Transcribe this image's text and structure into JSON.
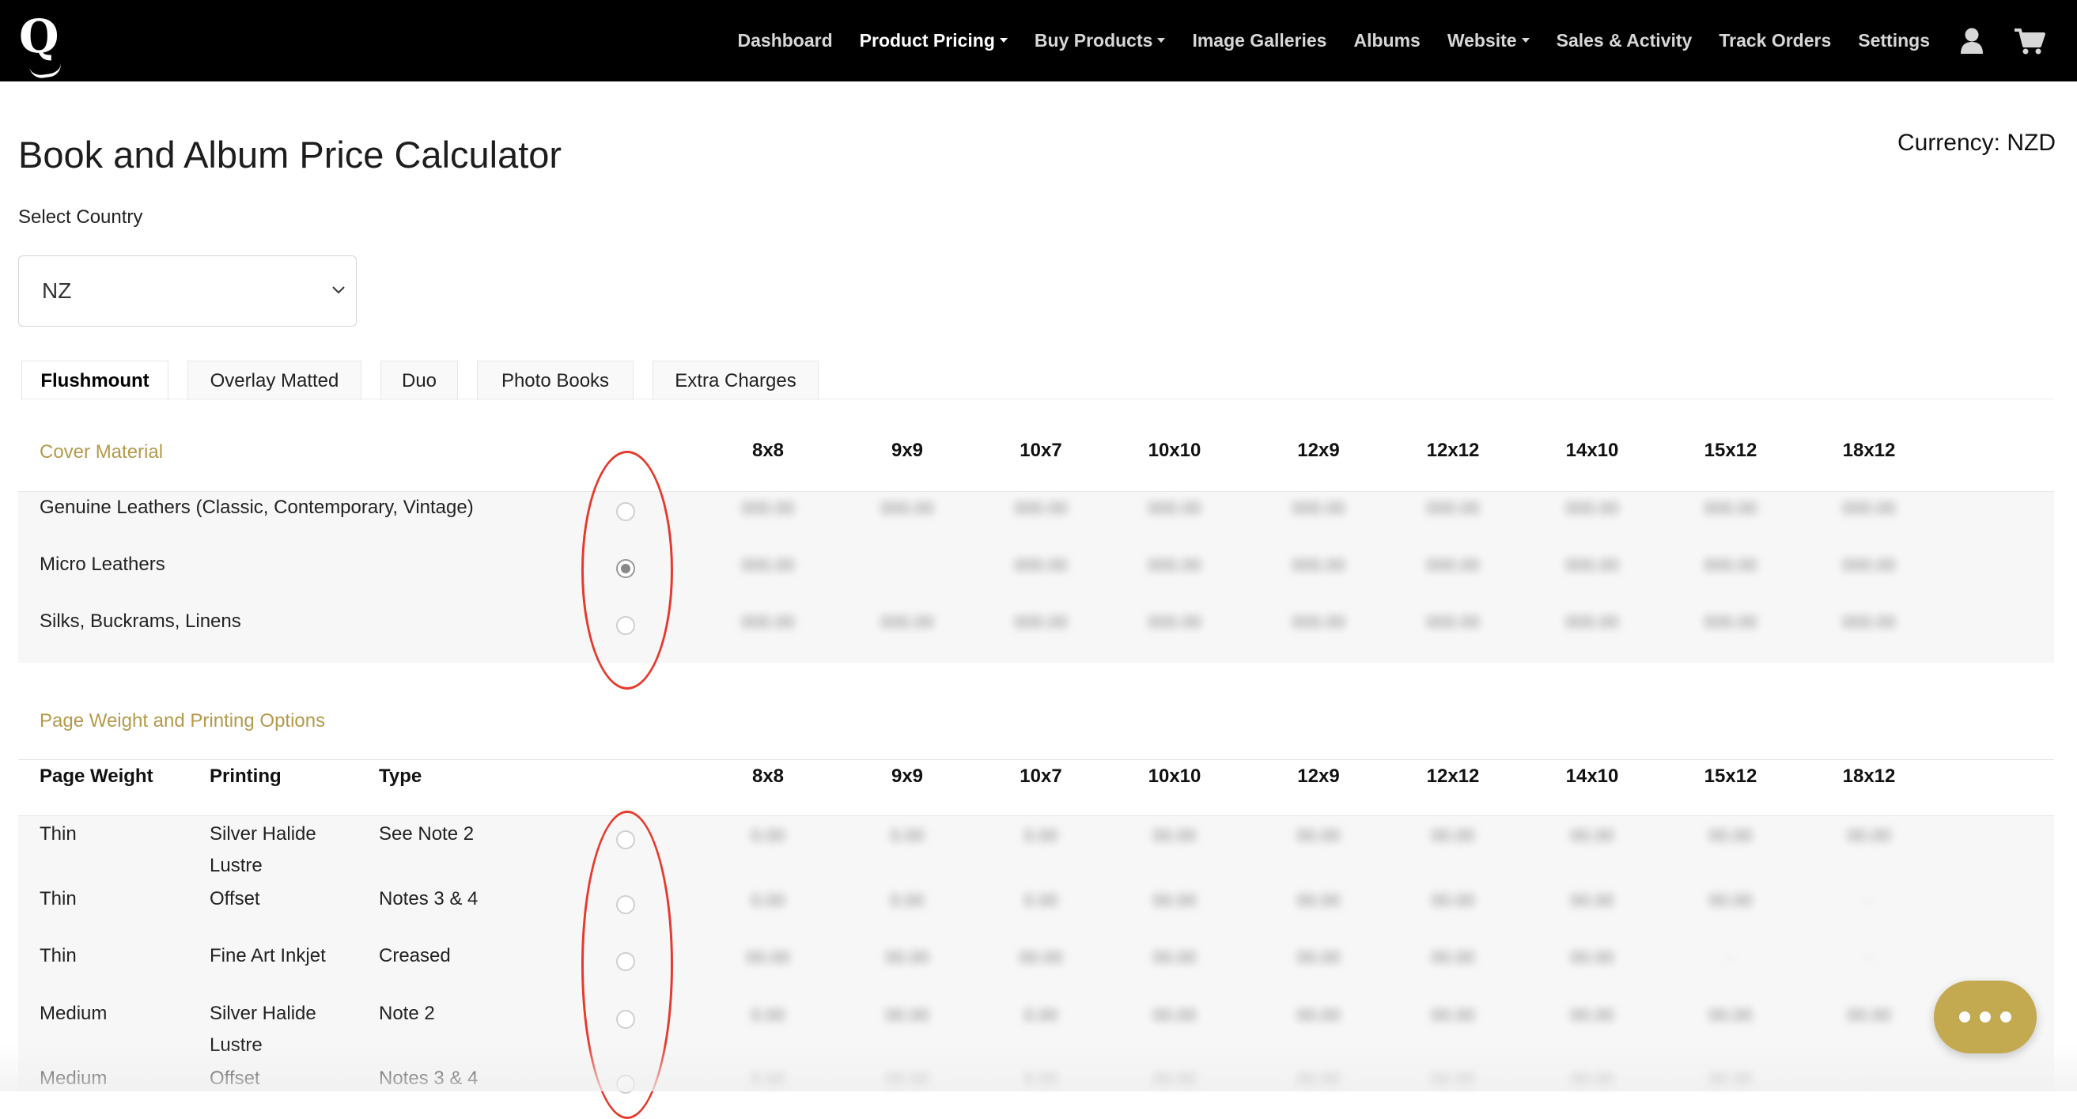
{
  "nav": {
    "items": [
      {
        "label": "Dashboard",
        "dropdown": false,
        "active": false
      },
      {
        "label": "Product Pricing",
        "dropdown": true,
        "active": true
      },
      {
        "label": "Buy Products",
        "dropdown": true,
        "active": false
      },
      {
        "label": "Image Galleries",
        "dropdown": false,
        "active": false
      },
      {
        "label": "Albums",
        "dropdown": false,
        "active": false
      },
      {
        "label": "Website",
        "dropdown": true,
        "active": false
      },
      {
        "label": "Sales & Activity",
        "dropdown": false,
        "active": false
      },
      {
        "label": "Track Orders",
        "dropdown": false,
        "active": false
      },
      {
        "label": "Settings",
        "dropdown": false,
        "active": false
      }
    ],
    "icons": [
      "user-icon",
      "cart-icon"
    ]
  },
  "page": {
    "title": "Book and Album Price Calculator",
    "currency": "Currency: NZD",
    "select_label": "Select Country",
    "country_value": "NZ"
  },
  "tabs": [
    "Flushmount",
    "Overlay Matted",
    "Duo",
    "Photo Books",
    "Extra Charges"
  ],
  "active_tab": "Flushmount",
  "sizes": [
    "8x8",
    "9x9",
    "10x7",
    "10x10",
    "12x9",
    "12x12",
    "14x10",
    "15x12",
    "18x12"
  ],
  "cover": {
    "title": "Cover Material",
    "rows": [
      {
        "label": "Genuine Leathers (Classic, Contemporary, Vintage)",
        "checked": false,
        "prices": [
          "000.00",
          "000.00",
          "000.00",
          "000.00",
          "000.00",
          "000.00",
          "000.00",
          "000.00",
          "000.00"
        ]
      },
      {
        "label": "Micro Leathers",
        "checked": true,
        "prices": [
          "000.00",
          "",
          "000.00",
          "000.00",
          "000.00",
          "000.00",
          "000.00",
          "000.00",
          "000.00"
        ]
      },
      {
        "label": "Silks, Buckrams, Linens",
        "checked": false,
        "prices": [
          "000.00",
          "000.00",
          "000.00",
          "000.00",
          "000.00",
          "000.00",
          "000.00",
          "000.00",
          "000.00"
        ]
      }
    ]
  },
  "pages": {
    "title": "Page Weight and Printing Options",
    "headers": [
      "Page Weight",
      "Printing",
      "Type"
    ],
    "rows": [
      {
        "weight": "Thin",
        "printing": "Silver Halide Lustre",
        "type": "See Note 2",
        "checked": false,
        "prices": [
          "0.00",
          "0.00",
          "0.00",
          "00.00",
          "00.00",
          "00.00",
          "00.00",
          "00.00",
          "00.00"
        ]
      },
      {
        "weight": "Thin",
        "printing": "Offset",
        "type": "Notes 3 & 4",
        "checked": false,
        "prices": [
          "0.00",
          "0.00",
          "0.00",
          "00.00",
          "00.00",
          "00.00",
          "00.00",
          "00.00",
          "-"
        ]
      },
      {
        "weight": "Thin",
        "printing": "Fine Art Inkjet",
        "type": "Creased",
        "checked": false,
        "prices": [
          "00.00",
          "00.00",
          "00.00",
          "00.00",
          "00.00",
          "00.00",
          "00.00",
          "-",
          "-"
        ]
      },
      {
        "weight": "Medium",
        "printing": "Silver Halide Lustre",
        "type": "Note 2",
        "checked": false,
        "prices": [
          "0.00",
          "00.00",
          "0.00",
          "00.00",
          "00.00",
          "00.00",
          "00.00",
          "00.00",
          "00.00"
        ]
      },
      {
        "weight": "Medium",
        "printing": "Offset",
        "type": "Notes 3 & 4",
        "checked": false,
        "prices": [
          "0.00",
          "00.00",
          "0.00",
          "00.00",
          "00.00",
          "00.00",
          "00.00",
          "00.00",
          "-"
        ]
      }
    ]
  },
  "annotation_color": "#e53a2c",
  "accent_color": "#b49a4b",
  "chat_button_color": "#c3a94f"
}
